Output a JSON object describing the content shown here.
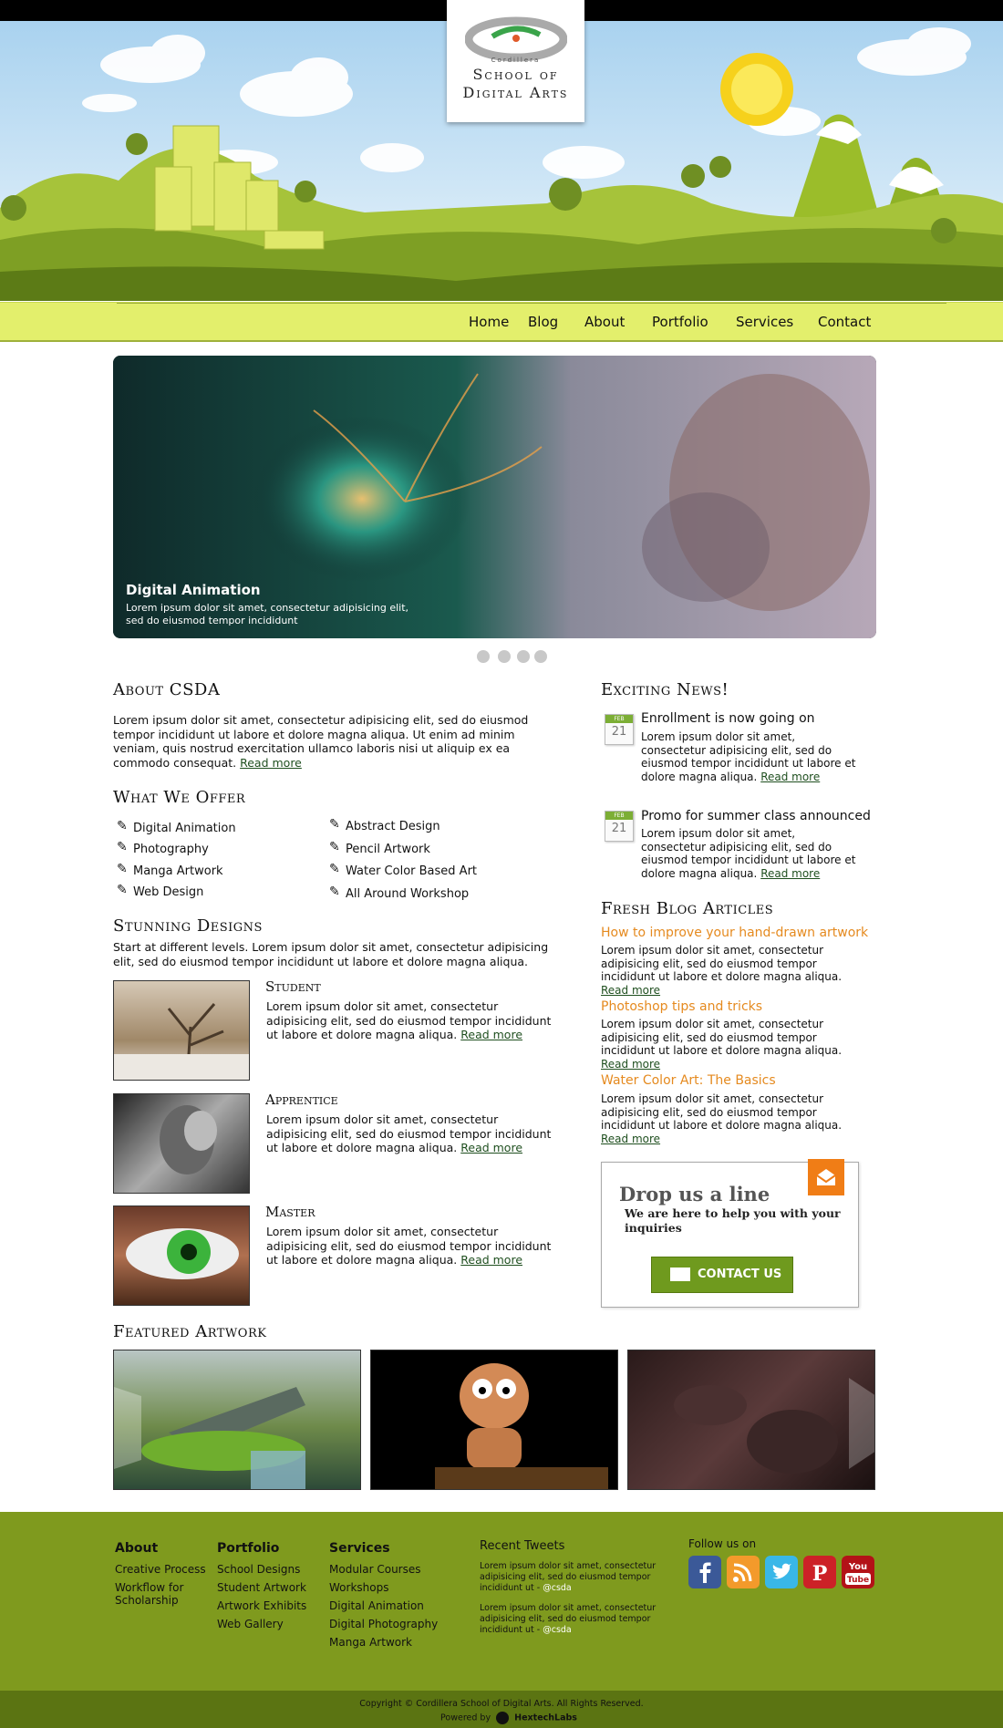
{
  "logo": {
    "small": "Cordillera",
    "line1": "School of",
    "line2": "Digital Arts"
  },
  "nav": [
    "Home",
    "Blog",
    "About",
    "Portfolio",
    "Services",
    "Contact"
  ],
  "slider": {
    "title": "Digital Animation",
    "text": "Lorem ipsum dolor sit amet, consectetur adipisicing elit, sed do eiusmod tempor incididunt"
  },
  "about": {
    "heading": "About CSDA",
    "text": "Lorem ipsum dolor sit amet, consectetur adipisicing elit, sed do eiusmod tempor incididunt ut labore et dolore magna aliqua. Ut enim ad minim veniam, quis nostrud exercitation ullamco laboris nisi ut aliquip ex ea commodo consequat.",
    "read_more": "Read more"
  },
  "offer": {
    "heading": "What We Offer",
    "col1": [
      "Digital Animation",
      "Photography",
      "Manga Artwork",
      "Web Design"
    ],
    "col2": [
      "Abstract Design",
      "Pencil Artwork",
      "Water Color Based Art",
      "All Around Workshop"
    ]
  },
  "designs": {
    "heading": "Stunning Designs",
    "intro": "Start at different levels. Lorem ipsum dolor sit amet, consectetur adipisicing elit, sed do eiusmod tempor incididunt ut labore et dolore magna aliqua.",
    "tiers": [
      {
        "title": "Student",
        "text": "Lorem ipsum dolor sit amet, consectetur adipisicing elit, sed do eiusmod tempor incididunt ut labore et dolore magna aliqua.",
        "read_more": "Read more"
      },
      {
        "title": "Apprentice",
        "text": "Lorem ipsum dolor sit amet, consectetur adipisicing elit, sed do eiusmod tempor incididunt ut labore et dolore magna aliqua.",
        "read_more": "Read more"
      },
      {
        "title": "Master",
        "text": "Lorem ipsum dolor sit amet, consectetur adipisicing elit, sed do eiusmod tempor incididunt ut labore et dolore magna aliqua.",
        "read_more": "Read more"
      }
    ]
  },
  "news": {
    "heading": "Exciting News!",
    "items": [
      {
        "month": "FEB",
        "day": "21",
        "title": "Enrollment is now going on",
        "text": "Lorem ipsum dolor sit amet, consectetur adipisicing elit, sed do eiusmod tempor incididunt ut labore et dolore magna aliqua.",
        "read_more": "Read more"
      },
      {
        "month": "FEB",
        "day": "21",
        "title": "Promo for summer class announced",
        "text": "Lorem ipsum dolor sit amet, consectetur adipisicing elit, sed do eiusmod tempor incididunt ut labore et dolore magna aliqua.",
        "read_more": "Read more"
      }
    ]
  },
  "blog": {
    "heading": "Fresh Blog Articles",
    "items": [
      {
        "title": "How to improve your hand-drawn artwork",
        "text": "Lorem ipsum dolor sit amet, consectetur adipisicing elit, sed do eiusmod tempor incididunt ut labore et dolore magna aliqua.",
        "read_more": "Read more"
      },
      {
        "title": "Photoshop tips and tricks",
        "text": "Lorem ipsum dolor sit amet, consectetur adipisicing elit, sed do eiusmod tempor incididunt ut labore et dolore magna aliqua.",
        "read_more": "Read more"
      },
      {
        "title": "Water Color Art: The Basics",
        "text": "Lorem ipsum dolor sit amet, consectetur adipisicing elit, sed do eiusmod tempor incididunt ut labore et dolore magna aliqua.",
        "read_more": "Read more"
      }
    ]
  },
  "contact": {
    "heading": "Drop us a line",
    "sub": "We are here to help you with your inquiries",
    "button": "CONTACT US"
  },
  "featured": {
    "heading": "Featured Artwork"
  },
  "footer": {
    "about": {
      "title": "About",
      "links": [
        "Creative Process",
        "Workflow for Scholarship"
      ]
    },
    "portfolio": {
      "title": "Portfolio",
      "links": [
        "School Designs",
        "Student Artwork",
        "Artwork Exhibits",
        "Web Gallery"
      ]
    },
    "services": {
      "title": "Services",
      "links": [
        "Modular Courses",
        "Workshops",
        "Digital Animation",
        "Digital Photography",
        "Manga Artwork"
      ]
    },
    "tweets": {
      "title": "Recent Tweets",
      "items": [
        {
          "text": "Lorem ipsum dolor sit amet, consectetur adipisicing elit, sed do eiusmod tempor incididunt ut -",
          "handle": "@csda"
        },
        {
          "text": "Lorem ipsum dolor sit amet, consectetur adipisicing elit, sed do eiusmod tempor incididunt ut -",
          "handle": "@csda"
        }
      ]
    },
    "follow": "Follow us on",
    "copyright": "Copyright © Cordillera School of Digital Arts. All Rights Reserved.",
    "powered": "Powered by",
    "powered_brand": "HextechLabs"
  },
  "colors": {
    "accent_green": "#7f9a1e",
    "nav_bg": "#e3ef6c",
    "blog_orange": "#e58a1f",
    "contact_orange": "#f07d16"
  }
}
